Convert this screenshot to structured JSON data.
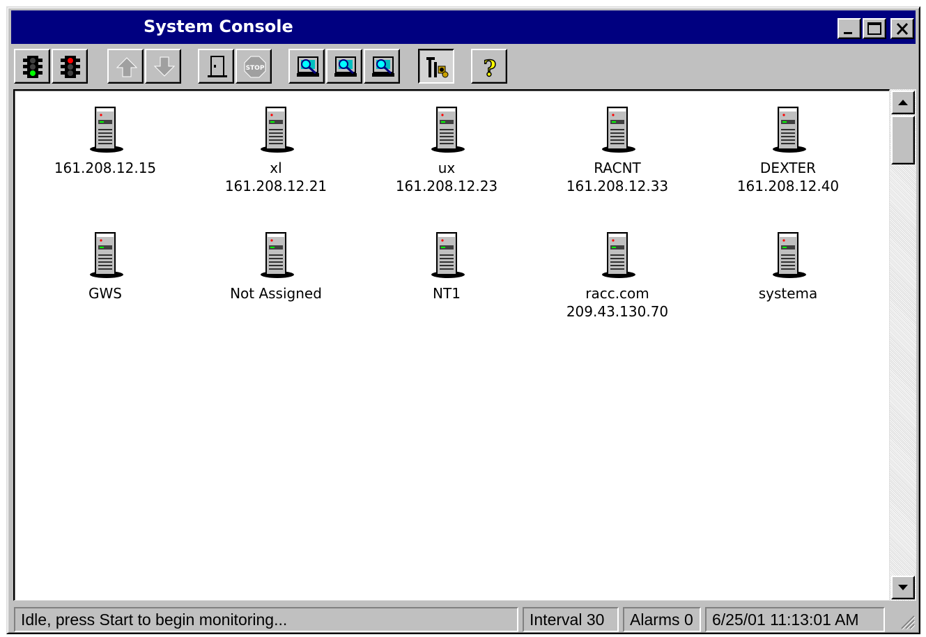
{
  "window": {
    "title": "System Console",
    "controls": [
      "minimize",
      "maximize",
      "close"
    ]
  },
  "toolbar": {
    "buttons": [
      {
        "name": "start-monitoring",
        "icon": "traffic-light-green-icon"
      },
      {
        "name": "stop-monitoring",
        "icon": "traffic-light-red-icon"
      },
      {
        "name": "move-up",
        "icon": "arrow-up-icon",
        "disabled": true
      },
      {
        "name": "move-down",
        "icon": "arrow-down-icon",
        "disabled": true
      },
      {
        "name": "door",
        "icon": "door-icon"
      },
      {
        "name": "stop",
        "icon": "stop-sign-icon",
        "disabled": true
      },
      {
        "name": "computer-search-1",
        "icon": "computer-search-icon"
      },
      {
        "name": "computer-search-2",
        "icon": "computer-search-icon"
      },
      {
        "name": "computer-search-3",
        "icon": "computer-search-icon"
      },
      {
        "name": "tools",
        "icon": "tools-icon",
        "pressed": true
      },
      {
        "name": "help",
        "icon": "help-question-icon"
      }
    ]
  },
  "hosts": [
    {
      "name": "",
      "address": "161.208.12.15"
    },
    {
      "name": "xl",
      "address": "161.208.12.21"
    },
    {
      "name": "ux",
      "address": "161.208.12.23"
    },
    {
      "name": "RACNT",
      "address": "161.208.12.33"
    },
    {
      "name": "DEXTER",
      "address": "161.208.12.40"
    },
    {
      "name": "GWS",
      "address": ""
    },
    {
      "name": "Not Assigned",
      "address": ""
    },
    {
      "name": "NT1",
      "address": ""
    },
    {
      "name": "racc.com",
      "address": "209.43.130.70"
    },
    {
      "name": "systema",
      "address": ""
    }
  ],
  "status": {
    "message": "Idle, press Start to begin monitoring...",
    "interval": "Interval 30",
    "alarms": "Alarms 0",
    "datetime": "6/25/01 11:13:01 AM"
  },
  "colors": {
    "titlebar": "#000080",
    "face": "#c0c0c0"
  }
}
